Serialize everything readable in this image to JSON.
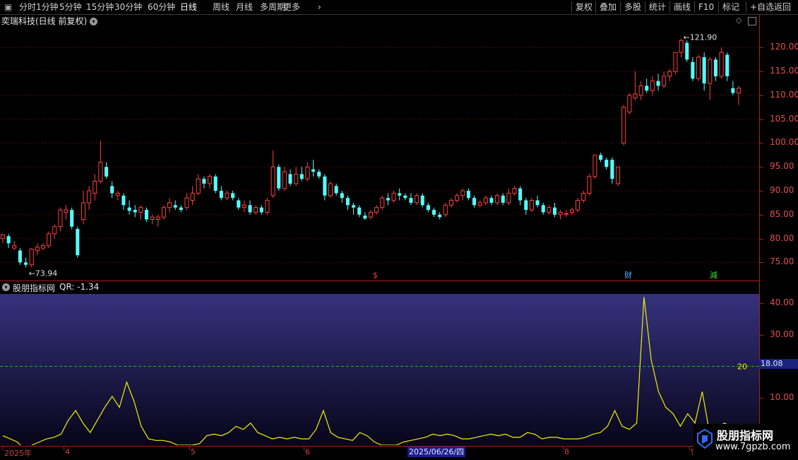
{
  "toolbar": {
    "left": [
      "分时",
      "1分钟",
      "5分钟",
      "15分钟",
      "30分钟",
      "60分钟",
      "日线",
      "周线",
      "月线",
      "多周期",
      "更多"
    ],
    "active": "日线",
    "more_arrow": "›",
    "right": [
      "复权",
      "叠加",
      "多股",
      "统计",
      "画线",
      "F10",
      "标记",
      "+自选",
      "返回"
    ]
  },
  "stock": {
    "title": "奕瑞科技(日线 前复权)"
  },
  "price_axis": {
    "labels": [
      "120.00",
      "115.00",
      "110.00",
      "105.00",
      "100.00",
      "95.00",
      "90.00",
      "85.00",
      "80.00",
      "75.00"
    ],
    "ylim": [
      71.5,
      124.5
    ]
  },
  "annotations": {
    "high": "121.90",
    "low": "73.94",
    "event_s": "$",
    "event_cai": "财",
    "event_jian": "減"
  },
  "indicator": {
    "header": "股朋指标网",
    "value_label": "QR: -1.34",
    "axis_labels": [
      "40.00",
      "30.00",
      "10.00"
    ],
    "threshold_label": "20",
    "current_badge": "18.08",
    "ylim": [
      -5,
      43
    ]
  },
  "date_axis": {
    "labels": [
      "2025年",
      "4",
      "5",
      "6",
      "8",
      "9"
    ],
    "hover": "2025/06/26/四"
  },
  "watermark": {
    "title": "股朋指标网",
    "url": "www.7gpzb.com"
  },
  "colors": {
    "up": "#ff4040",
    "down": "#54ffff",
    "line": "#f0f000",
    "dash": "#00d000",
    "grid": "#7a1010"
  },
  "chart_data": [
    {
      "type": "candlestick",
      "title": "奕瑞科技(日线 前复权)",
      "ylim": [
        71.5,
        124.5
      ],
      "candles": [
        [
          80,
          81,
          79,
          80.8
        ],
        [
          80.5,
          81,
          78,
          79
        ],
        [
          78,
          79.5,
          77.5,
          78.5
        ],
        [
          77.5,
          78,
          74.5,
          75
        ],
        [
          75,
          76,
          73.94,
          74.5
        ],
        [
          74.5,
          78,
          74,
          77.8
        ],
        [
          77.5,
          79,
          76.5,
          78.2
        ],
        [
          78,
          79,
          77.5,
          78.5
        ],
        [
          78.5,
          81.5,
          78,
          81
        ],
        [
          81,
          83,
          80,
          82.5
        ],
        [
          82.5,
          86.5,
          81.5,
          86
        ],
        [
          85.5,
          87,
          84,
          86
        ],
        [
          86,
          86.5,
          82,
          82.5
        ],
        [
          82,
          82.5,
          76,
          76.5
        ],
        [
          84,
          90,
          83,
          87.5
        ],
        [
          87.5,
          91,
          86,
          90
        ],
        [
          89.5,
          93.5,
          88,
          92
        ],
        [
          92,
          100.5,
          91.5,
          96
        ],
        [
          95,
          96,
          92.5,
          93
        ],
        [
          91,
          92,
          88.5,
          89.5
        ],
        [
          89,
          90,
          88,
          89.5
        ],
        [
          89,
          89.5,
          86,
          87
        ],
        [
          86.5,
          88,
          85,
          85.8
        ],
        [
          86,
          87,
          84.5,
          85.5
        ],
        [
          85.5,
          87,
          84,
          86.5
        ],
        [
          86,
          86.5,
          83.5,
          84
        ],
        [
          84,
          85,
          83,
          84.5
        ],
        [
          84,
          85,
          82.5,
          84.5
        ],
        [
          84.5,
          87,
          84,
          86.5
        ],
        [
          86.5,
          88.5,
          85.5,
          87.5
        ],
        [
          87,
          88,
          86,
          86.5
        ],
        [
          86.5,
          87,
          85.5,
          86
        ],
        [
          86.5,
          89.5,
          86,
          88.5
        ],
        [
          88,
          91,
          87,
          89.5
        ],
        [
          89.5,
          93.5,
          89,
          92.5
        ],
        [
          92.5,
          93,
          90.5,
          91.5
        ],
        [
          91.5,
          93.5,
          90.5,
          93
        ],
        [
          93,
          93.5,
          89.5,
          90
        ],
        [
          90,
          91,
          88,
          88.5
        ],
        [
          88.5,
          90,
          88,
          89.5
        ],
        [
          89.5,
          90,
          88,
          88.5
        ],
        [
          88,
          88.5,
          86,
          86.5
        ],
        [
          86.5,
          88,
          85.5,
          87
        ],
        [
          87,
          88,
          85,
          85.5
        ],
        [
          85.5,
          87,
          85,
          86.5
        ],
        [
          86.5,
          87,
          85,
          85.5
        ],
        [
          85.5,
          88.5,
          85,
          88
        ],
        [
          89,
          98.5,
          88.5,
          95
        ],
        [
          95,
          95.5,
          90,
          90.5
        ],
        [
          90.5,
          95,
          90,
          94
        ],
        [
          93.5,
          94.5,
          91,
          91.5
        ],
        [
          91.5,
          95,
          91,
          93.5
        ],
        [
          93.5,
          95,
          92,
          92.5
        ],
        [
          92.5,
          96,
          92,
          95
        ],
        [
          94.5,
          96.5,
          93,
          94
        ],
        [
          94,
          94.5,
          92.5,
          93
        ],
        [
          93,
          93.5,
          88,
          89
        ],
        [
          89,
          92,
          88.5,
          91.5
        ],
        [
          91,
          91.5,
          89,
          89.5
        ],
        [
          89.5,
          90,
          87.5,
          88.5
        ],
        [
          88.5,
          89,
          86,
          87
        ],
        [
          87,
          87.5,
          85,
          86.5
        ],
        [
          86.5,
          87,
          84.5,
          85
        ],
        [
          84.8,
          85.5,
          83.9,
          84.2
        ],
        [
          84.5,
          86,
          84,
          85.5
        ],
        [
          85.5,
          87,
          85,
          86.5
        ],
        [
          86.5,
          89,
          86,
          88.5
        ],
        [
          88.5,
          89.5,
          87,
          88
        ],
        [
          88,
          90,
          87.5,
          89.5
        ],
        [
          89.5,
          90.5,
          88,
          89
        ],
        [
          89,
          89.5,
          88,
          88.5
        ],
        [
          88.5,
          89.5,
          87,
          87.5
        ],
        [
          87.5,
          89.5,
          87,
          89
        ],
        [
          89,
          89.5,
          86.5,
          87
        ],
        [
          87,
          87.5,
          85.5,
          86
        ],
        [
          86,
          86.5,
          84.5,
          85
        ],
        [
          85,
          85.5,
          84,
          84.5
        ],
        [
          85,
          87.5,
          84.5,
          87
        ],
        [
          87,
          88.5,
          86.5,
          88
        ],
        [
          88,
          89.5,
          87.5,
          89
        ],
        [
          89,
          90.5,
          88,
          90
        ],
        [
          90,
          90.5,
          88,
          88.5
        ],
        [
          88.5,
          89,
          86.5,
          87
        ],
        [
          87,
          88,
          86.5,
          87.5
        ],
        [
          87.5,
          89,
          87,
          88.5
        ],
        [
          88.5,
          89,
          87,
          87.5
        ],
        [
          87.5,
          89.5,
          87,
          89
        ],
        [
          89,
          89.5,
          87,
          87.5
        ],
        [
          87.5,
          90.5,
          87,
          89.5
        ],
        [
          89.5,
          91,
          89,
          90.5
        ],
        [
          90.5,
          91,
          87,
          88
        ],
        [
          88,
          88.5,
          85,
          86
        ],
        [
          86,
          88.5,
          85.5,
          88
        ],
        [
          88,
          89,
          86.5,
          87
        ],
        [
          87,
          87.5,
          85,
          85.5
        ],
        [
          85.5,
          87,
          85,
          86.5
        ],
        [
          86.5,
          87.5,
          84.5,
          85
        ],
        [
          85,
          86,
          84,
          85.5
        ],
        [
          85,
          86,
          84.5,
          85.2
        ],
        [
          85.5,
          86.5,
          85,
          86
        ],
        [
          86,
          88.5,
          85.5,
          88
        ],
        [
          88,
          90,
          87.5,
          89.5
        ],
        [
          89.5,
          93.5,
          89,
          93
        ],
        [
          93,
          97.5,
          92.5,
          97.5
        ],
        [
          97.5,
          98,
          96,
          96.5
        ],
        [
          96.5,
          97,
          94.5,
          95
        ],
        [
          96.5,
          97,
          91.5,
          92.5
        ],
        [
          91.5,
          95,
          91,
          95
        ],
        [
          100,
          108,
          99.5,
          107.5
        ],
        [
          106.5,
          110.5,
          106,
          110
        ],
        [
          109.5,
          115,
          109,
          110.3
        ],
        [
          110,
          113,
          109,
          112
        ],
        [
          112,
          113.5,
          110.5,
          111
        ],
        [
          111,
          114,
          110,
          113
        ],
        [
          113,
          114.5,
          111,
          112
        ],
        [
          112,
          115,
          111.5,
          114
        ],
        [
          114,
          115.5,
          113,
          115
        ],
        [
          115,
          119,
          114.5,
          119
        ],
        [
          119,
          121.9,
          118,
          121.5
        ],
        [
          121,
          121.5,
          117,
          117.5
        ],
        [
          117,
          118,
          113,
          113.5
        ],
        [
          113.5,
          118.5,
          113,
          118
        ],
        [
          118,
          119,
          111,
          112.5
        ],
        [
          112.5,
          118,
          109,
          117.5
        ],
        [
          117.5,
          118,
          113,
          114
        ],
        [
          114,
          120,
          113.5,
          119
        ],
        [
          118.5,
          119,
          113,
          114
        ],
        [
          111.5,
          113,
          110,
          110.5
        ],
        [
          110.5,
          112,
          108,
          111.5
        ]
      ]
    },
    {
      "type": "line",
      "series": [
        {
          "name": "QR",
          "values": [
            -2,
            -3,
            -4,
            -6.5,
            -5,
            -4,
            -3,
            -2.5,
            -1.5,
            3,
            6,
            2,
            -1,
            3,
            7,
            10.5,
            7,
            15,
            9,
            1,
            -3,
            -3.5,
            -3.5,
            -4,
            -5,
            -5,
            -5,
            -4.5,
            -2,
            -1.5,
            -2,
            -1,
            1,
            0,
            2,
            -1,
            -2,
            -3,
            -2.5,
            -3,
            -2.5,
            -3,
            -3,
            0,
            6,
            -1,
            -2.5,
            -3,
            -3.5,
            -1,
            -2,
            -4,
            -5,
            -5,
            -5,
            -4,
            -3.5,
            -3,
            -2.5,
            -1.5,
            -2,
            -1.5,
            -2,
            -3,
            -3,
            -2.5,
            -2,
            -1.5,
            -2,
            -1.5,
            -2.5,
            -2.5,
            -1,
            -1.5,
            -3,
            -2.5,
            -2.5,
            -3,
            -3,
            -3,
            -2.5,
            -1.5,
            -1,
            1,
            6,
            1,
            0,
            2,
            42,
            22,
            12,
            7,
            5,
            1,
            5,
            2,
            12,
            -1,
            0,
            2,
            1,
            -1
          ]
        }
      ],
      "threshold": 20,
      "ylim": [
        -5,
        43
      ]
    }
  ]
}
